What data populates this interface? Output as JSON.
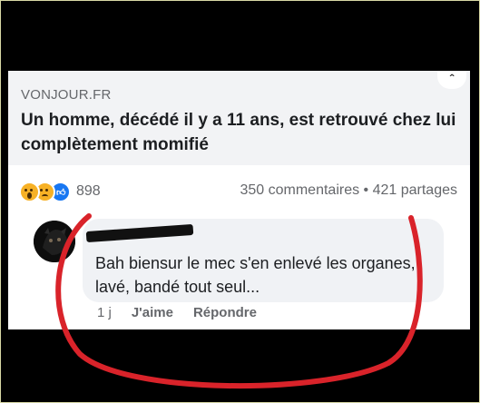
{
  "post": {
    "domain": "VONJOUR.FR",
    "headline": "Un homme, décédé il y a 11 ans, est retrouvé chez lui complètement momifié",
    "more_icon": "chevron-up-icon",
    "more_glyph": "ˆ"
  },
  "reactions": {
    "icons": [
      "wow-icon",
      "sad-icon",
      "like-icon"
    ],
    "count": "898"
  },
  "stats": {
    "text": "350 commentaires • 421 partages"
  },
  "comment": {
    "author": "",
    "text": "Bah biensur le mec s'en enlevé les organes, lavé, bandé tout seul...",
    "time": "1 j",
    "like_label": "J'aime",
    "reply_label": "Répondre"
  },
  "colors": {
    "background": "#000000",
    "card": "#f2f3f5",
    "secondary_text": "#65676b",
    "annotation_red": "#d9232a",
    "like_blue": "#1877f2",
    "emoji_yellow": "#f7b125"
  }
}
